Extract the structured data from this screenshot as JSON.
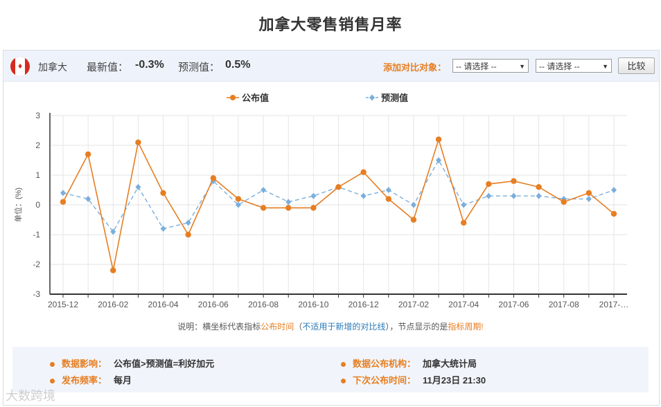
{
  "page": {
    "title": "加拿大零售销售月率"
  },
  "header": {
    "country": "加拿大",
    "latest_label": "最新值：",
    "latest_value": "-0.3%",
    "forecast_label": "预测值：",
    "forecast_value": "0.5%",
    "compare_label": "添加对比对象：",
    "select1": "-- 请选择 --",
    "select2": "-- 请选择 --",
    "compare_button": "比较"
  },
  "chart_data": {
    "type": "line",
    "ylabel": "单位：(%)",
    "ylim": [
      -3,
      3
    ],
    "yticks": [
      3,
      2,
      1,
      0,
      -1,
      -2,
      -3
    ],
    "x": [
      "2015-12",
      "2016-01",
      "2016-02",
      "2016-03",
      "2016-04",
      "2016-05",
      "2016-06",
      "2016-07",
      "2016-08",
      "2016-09",
      "2016-10",
      "2016-11",
      "2016-12",
      "2017-01",
      "2017-02",
      "2017-03",
      "2017-04",
      "2017-05",
      "2017-06",
      "2017-07",
      "2017-08",
      "2017-09",
      "2017-10"
    ],
    "xtick_labels": [
      "2015-12",
      "",
      "2016-02",
      "",
      "2016-04",
      "",
      "2016-06",
      "",
      "2016-08",
      "",
      "2016-10",
      "",
      "2016-12",
      "",
      "2017-02",
      "",
      "2017-04",
      "",
      "2017-06",
      "",
      "2017-08",
      "",
      "2017-…"
    ],
    "grid": true,
    "legend_position": "top",
    "series": [
      {
        "name": "公布值",
        "color": "#e67e22",
        "style": "solid",
        "marker": "circle",
        "values": [
          0.1,
          1.7,
          -2.2,
          2.1,
          0.4,
          -1.0,
          0.9,
          0.2,
          -0.1,
          -0.1,
          -0.1,
          0.6,
          1.1,
          0.2,
          -0.5,
          2.2,
          -0.6,
          0.7,
          0.8,
          0.6,
          0.1,
          0.4,
          -0.3
        ]
      },
      {
        "name": "预测值",
        "color": "#7aaedc",
        "style": "dashed",
        "marker": "diamond",
        "values": [
          0.4,
          0.2,
          -0.9,
          0.6,
          -0.8,
          -0.6,
          0.8,
          0.0,
          0.5,
          0.1,
          0.3,
          0.6,
          0.3,
          0.5,
          0.0,
          1.5,
          0.0,
          0.3,
          0.3,
          0.3,
          0.2,
          0.2,
          0.5
        ]
      }
    ]
  },
  "note": {
    "prefix": "说明：横坐标代表指标",
    "release": "公布时间",
    "paren_open": "（",
    "not_applicable": "不适用于新增的对比线",
    "paren_close": "），节点显示的是",
    "period": "指标周期!"
  },
  "info": {
    "impact_label": "数据影响：",
    "impact_value": "公布值>预测值=利好加元",
    "source_label": "数据公布机构：",
    "source_value": "加拿大统计局",
    "frequency_label": "发布频率：",
    "frequency_value": "每月",
    "next_label": "下次公布时间：",
    "next_value": "11月23日 21:30"
  },
  "watermark": "大数跨境",
  "colors": {
    "accent": "#e67e22",
    "forecast": "#7aaedc",
    "topbar": "#eef3fb"
  }
}
